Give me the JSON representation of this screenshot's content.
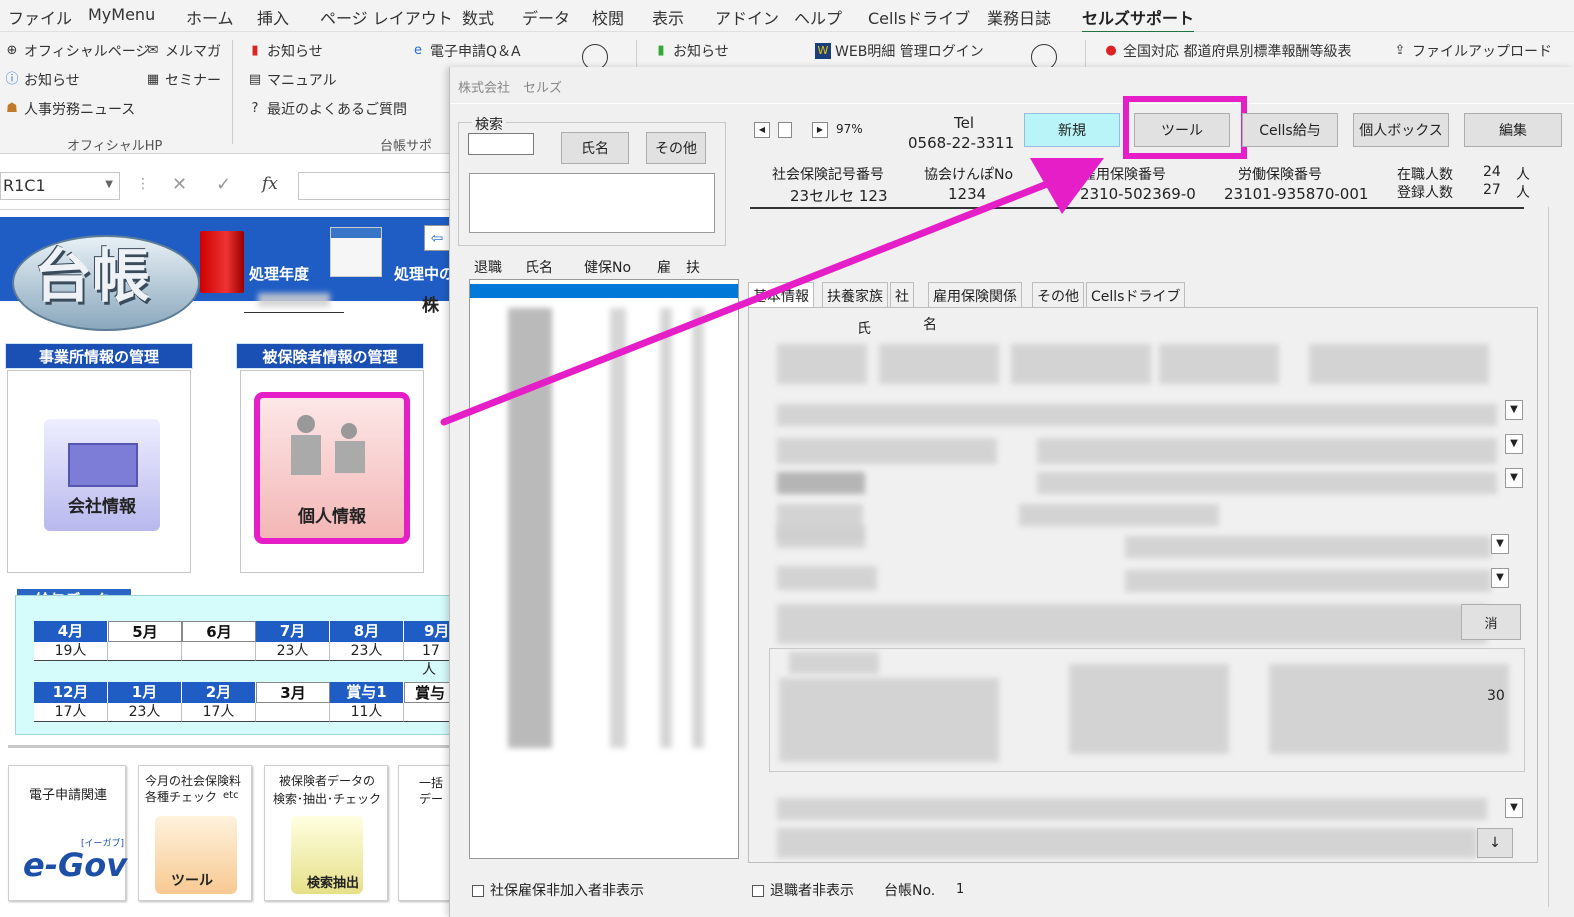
{
  "menubar": {
    "items": [
      "ファイル",
      "MyMenu",
      "ホーム",
      "挿入",
      "ページ レイアウト",
      "数式",
      "データ",
      "校閲",
      "表示",
      "アドイン",
      "ヘルプ",
      "Cellsドライブ",
      "業務日誌",
      "セルズサポート"
    ]
  },
  "ribbon": {
    "official_page": "オフィシャルページ",
    "mailmag": "メルマガ",
    "notice1": "お知らせ",
    "seminar": "セミナー",
    "news": "人事労務ニュース",
    "group1": "オフィシャルHP",
    "notice2": "お知らせ",
    "manual": "マニュアル",
    "faq": "最近のよくあるご質問",
    "group2": "台帳サポ",
    "egov_qa": "電子申請Q＆A",
    "notice3": "お知らせ",
    "web_meisai": "WEB明細 管理ログイン",
    "zenkoku": "全国対応 都道府県別標準報酬等級表",
    "upload": "ファイルアップロード"
  },
  "formula": {
    "namebox": "R1C1",
    "fx": "fx"
  },
  "sheet": {
    "logo": "台帳",
    "shori_nendo": "処理年度",
    "shori_chu": "処理中の",
    "kabu": "株",
    "sect_jigyosho": "事業所情報の管理",
    "sect_hihoken": "被保険者情報の管理",
    "btn_company": "会社情報",
    "btn_person": "個人情報",
    "salary_title": "給与データ",
    "months_row1": [
      "4月",
      "5月",
      "6月",
      "7月",
      "8月",
      "9月"
    ],
    "values_row1": [
      "19人",
      "",
      "",
      "23人",
      "23人",
      "17人"
    ],
    "months_row2": [
      "12月",
      "1月",
      "2月",
      "3月",
      "賞与1",
      "賞与"
    ],
    "values_row2": [
      "17人",
      "23人",
      "17人",
      "",
      "11人",
      ""
    ],
    "tile1": "電子申請関連",
    "tile1_logo": "e-Gov",
    "tile1_sub": "[イーガブ]",
    "tile2_line1": "今月の社会保険料",
    "tile2_line2": "各種チェック",
    "tile2_etc": "etc",
    "tile2_label": "ツール",
    "tile3_line1": "被保険者データの",
    "tile3_line2": "検索･抽出･チェック",
    "tile3_label": "検索抽出",
    "tile4_line1": "一括",
    "tile4_line2": "デー"
  },
  "dialog": {
    "company": "株式会社　セルズ",
    "search_group": "検索",
    "btn_name": "氏名",
    "btn_other": "その他",
    "list_headers": [
      "退職",
      "氏名",
      "健保No",
      "雇",
      "扶"
    ],
    "zoom": "97%",
    "tel_label": "Tel",
    "tel": "0568-22-3311",
    "btn_new": "新規",
    "btn_tool": "ツール",
    "btn_cells_salary": "Cells給与",
    "btn_personal_box": "個人ボックス",
    "btn_edit": "編集",
    "shaho_label": "社会保険記号番号",
    "shaho_value": "23セルセ 123",
    "kyokai_label": "協会けんぽNo",
    "kyokai_value": "1234",
    "koyo_label": "雇用保険番号",
    "koyo_value": "2310-502369-0",
    "rodo_label": "労働保険番号",
    "rodo_value": "23101-935870-001",
    "zaishoku_label": "在職人数",
    "zaishoku_value": "24",
    "toroku_label": "登録人数",
    "toroku_value": "27",
    "unit": "人",
    "tabs": [
      "基本情報",
      "扶養家族",
      "社",
      "雇用保険関係",
      "その他",
      "Cellsドライブ"
    ],
    "field_shi": "氏",
    "field_mei": "名",
    "side_text": "30",
    "cancel_partial": "消",
    "chk_shaho": "社保雇保非加入者非表示",
    "chk_taishoku": "退職者非表示",
    "daicho_no_label": "台帳No.",
    "daicho_no": "1"
  },
  "colors": {
    "highlight": "#e61ec8",
    "blue_band": "#1f5dc5",
    "new_button": "#b8f4f8",
    "salary_bg": "#d6fbfb"
  }
}
